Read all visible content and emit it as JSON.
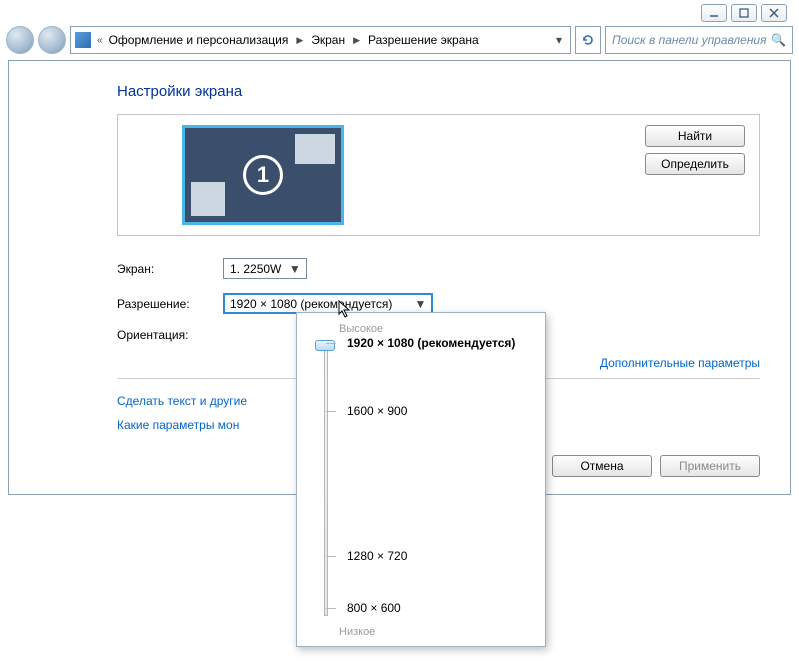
{
  "window_controls": {
    "min": "minimize",
    "max": "maximize",
    "close": "close"
  },
  "breadcrumb": {
    "items": [
      "Оформление и персонализация",
      "Экран",
      "Разрешение экрана"
    ]
  },
  "search": {
    "placeholder": "Поиск в панели управления"
  },
  "page_title": "Настройки экрана",
  "preview": {
    "monitor_number": "1",
    "find_btn": "Найти",
    "identify_btn": "Определить"
  },
  "form": {
    "screen_label": "Экран:",
    "screen_value": "1. 2250W",
    "resolution_label": "Разрешение:",
    "resolution_value": "1920 × 1080 (рекомендуется)",
    "orientation_label": "Ориентация:"
  },
  "advanced_link": "Дополнительные параметры",
  "links": {
    "text_size": "Сделать текст и другие",
    "which_params": "Какие параметры мон"
  },
  "actions": {
    "cancel": "Отмена",
    "apply": "Применить"
  },
  "res_dropdown": {
    "high": "Высокое",
    "low": "Низкое",
    "options": [
      {
        "label": "1920 × 1080 (рекомендуется)",
        "pos": 0,
        "selected": true
      },
      {
        "label": "1600 × 900",
        "pos": 25,
        "selected": false
      },
      {
        "label": "1280 × 720",
        "pos": 78,
        "selected": false
      },
      {
        "label": "800 × 600",
        "pos": 97,
        "selected": false
      }
    ]
  }
}
